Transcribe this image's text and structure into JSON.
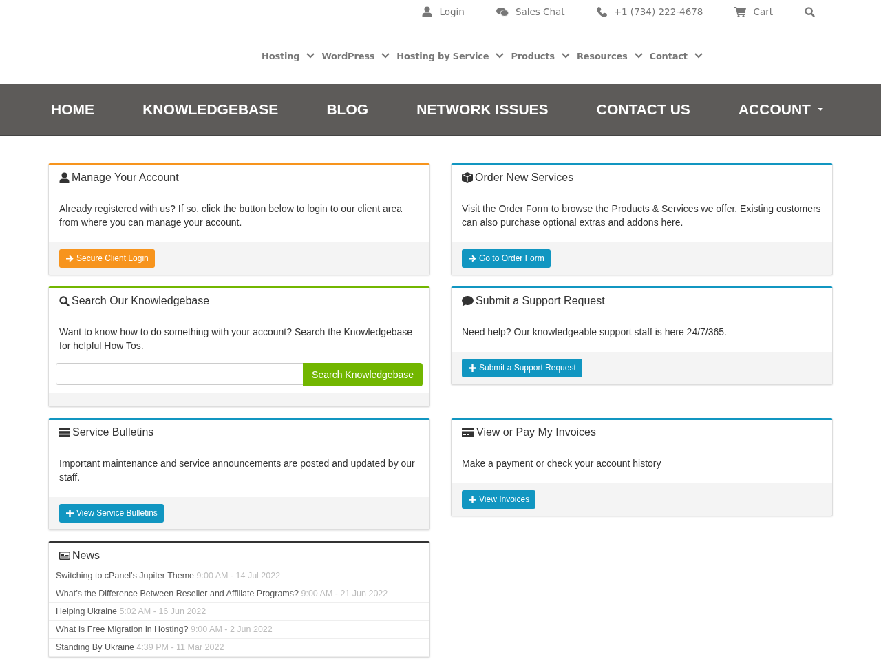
{
  "top_links": [
    {
      "label": "Login"
    },
    {
      "label": "Sales Chat"
    },
    {
      "label": "+1 (734) 222-4678"
    },
    {
      "label": "Cart"
    }
  ],
  "sub_nav": [
    "Hosting",
    "WordPress",
    "Hosting by Service",
    "Products",
    "Resources",
    "Contact"
  ],
  "main_nav": [
    {
      "label": "HOME",
      "dropdown": false
    },
    {
      "label": "KNOWLEDGEBASE",
      "dropdown": false
    },
    {
      "label": "BLOG",
      "dropdown": false
    },
    {
      "label": "NETWORK ISSUES",
      "dropdown": false
    },
    {
      "label": "CONTACT US",
      "dropdown": false
    },
    {
      "label": "ACCOUNT",
      "dropdown": true
    }
  ],
  "panels": [
    {
      "kind": "action",
      "title": "Manage Your Account",
      "color": "#f7941d",
      "text": "Already registered with us? If so, click the button below to login to our client area from where you can manage your account.",
      "button": "Secure Client Login"
    },
    {
      "kind": "action",
      "title": "Order New Services",
      "color": "#1196c1",
      "text": "Visit the Order Form to browse the Products & Services we offer. Existing customers can also purchase optional extras and addons here.",
      "button": "Go to Order Form"
    },
    {
      "kind": "search",
      "title": "Search Our Knowledgebase",
      "color": "#72b600",
      "text": "Want to know how to do something with your account? Search the Knowledgebase for helpful How Tos.",
      "button": "Search Knowledgebase"
    },
    {
      "kind": "action",
      "title": "Submit a Support Request",
      "color": "#1196c1",
      "text": "Need help? Our knowledgeable support staff is here 24/7/365.",
      "button": "Submit a Support Request"
    },
    {
      "kind": "action",
      "title": "Service Bulletins",
      "color": "#1196c1",
      "text": "Important maintenance and service announcements are posted and updated by our staff.",
      "button": "View Service Bulletins"
    },
    {
      "kind": "action",
      "title": "View or Pay My Invoices",
      "color": "#1196c1",
      "text": "Make a payment or check your account history",
      "button": "View Invoices"
    },
    {
      "kind": "news",
      "title": "News",
      "color": "#333333",
      "items": [
        {
          "title": "Switching to cPanel’s Jupiter Theme",
          "date": "9:00 AM - 14 Jul 2022"
        },
        {
          "title": "What’s the Difference Between Reseller and Affiliate Programs?",
          "date": "9:00 AM - 21 Jun 2022"
        },
        {
          "title": "Helping Ukraine",
          "date": "5:02 AM - 16 Jun 2022"
        },
        {
          "title": "What Is Free Migration in Hosting?",
          "date": "9:00 AM - 2 Jun 2022"
        },
        {
          "title": "Standing By Ukraine",
          "date": "4:39 PM - 11 Mar 2022"
        }
      ]
    }
  ]
}
